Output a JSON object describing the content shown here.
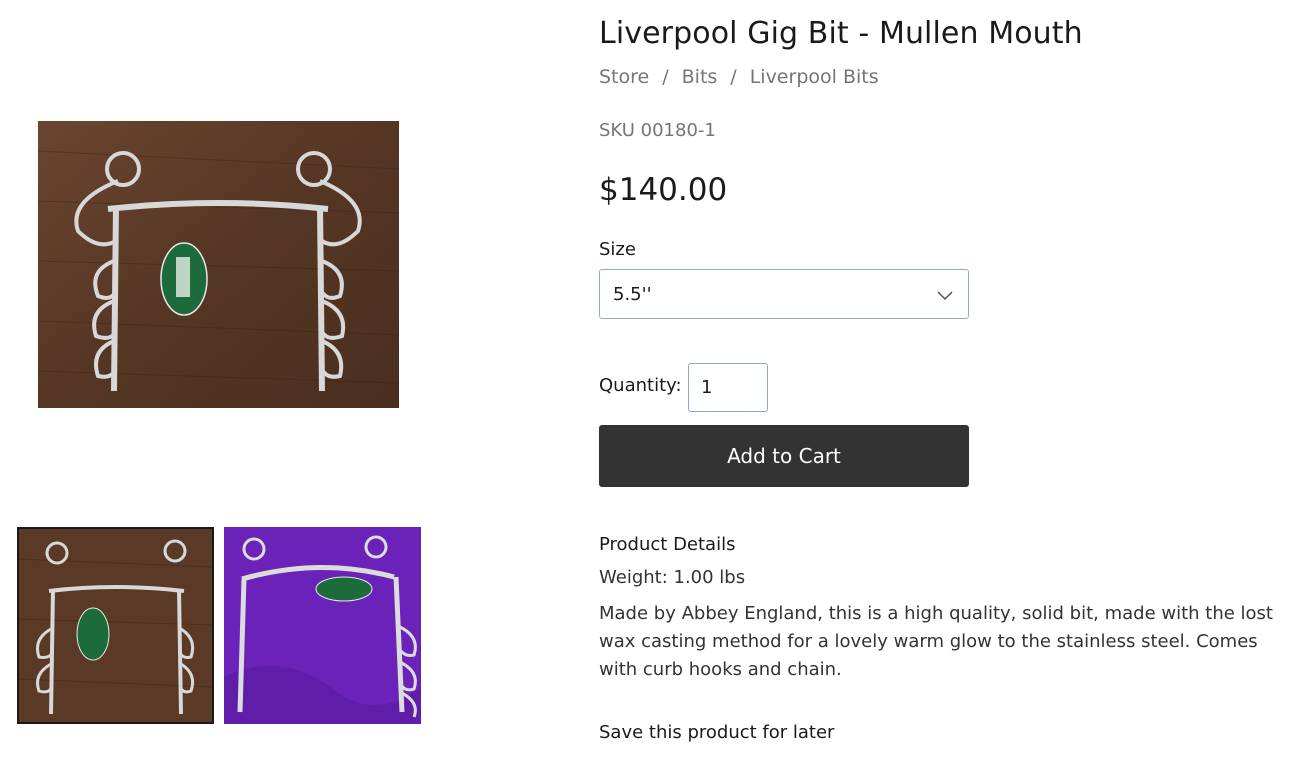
{
  "product": {
    "title": "Liverpool Gig Bit - Mullen Mouth",
    "breadcrumb": [
      "Store",
      "Bits",
      "Liverpool Bits"
    ],
    "breadcrumb_separator": "/",
    "sku": "SKU 00180-1",
    "price": "$140.00"
  },
  "options": {
    "size_label": "Size",
    "size_selected": "5.5''"
  },
  "quantity": {
    "label": "Quantity:",
    "value": "1"
  },
  "cart": {
    "add_label": "Add to Cart"
  },
  "details": {
    "heading": "Product Details",
    "weight": "Weight: 1.00 lbs",
    "description": "Made by Abbey England, this is a high quality, solid bit, made with the lost wax casting method for a lovely warm glow to the stainless steel. Comes with curb hooks and chain."
  },
  "save": {
    "label": "Save this product for later"
  },
  "gallery": {
    "thumbnail_count": 2,
    "selected_index": 0
  },
  "colors": {
    "button_bg": "#333333",
    "muted_text": "#757575",
    "input_border": "#8fa9c9",
    "wood": "#5b3a27",
    "purple": "#6a22b8"
  }
}
